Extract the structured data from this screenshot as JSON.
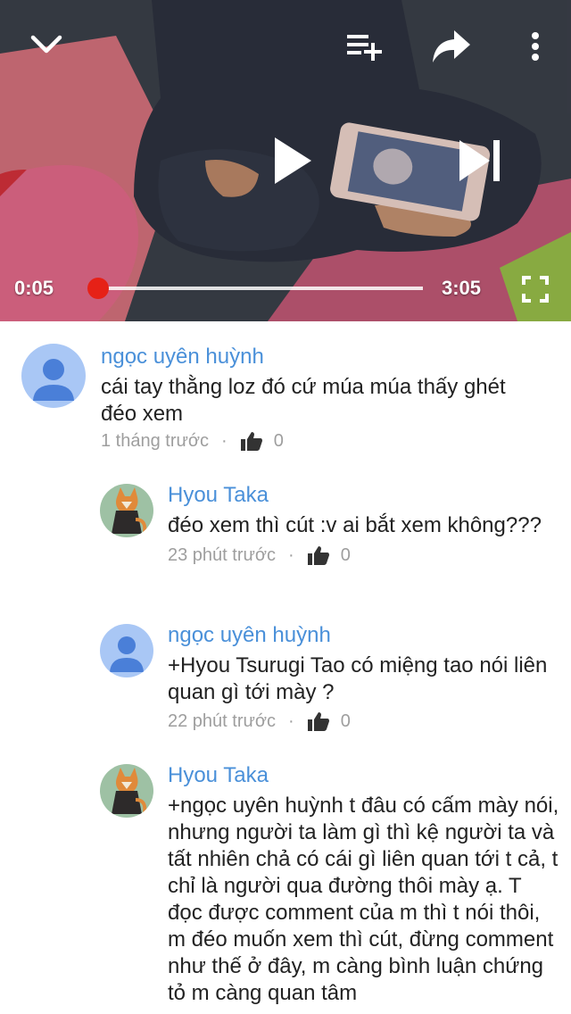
{
  "player": {
    "current_time": "0:05",
    "duration": "3:05",
    "progress": 0.027,
    "icons": {
      "collapse": "chevron-down-icon",
      "add_to_playlist": "playlist-add-icon",
      "share": "share-icon",
      "more": "more-vert-icon",
      "play": "play-icon",
      "next": "skip-next-icon",
      "fullscreen": "fullscreen-icon"
    },
    "accent": "#e62117"
  },
  "comments": [
    {
      "author": "ngọc uyên huỳnh",
      "text": "cái tay thằng loz đó cứ múa múa thấy ghét đéo xem",
      "time": "1 tháng trước",
      "likes": "0",
      "avatar": "default-avatar"
    },
    {
      "author": "Hyou Taka",
      "text": "đéo xem thì cút :v ai bắt xem không???",
      "time": "23 phút trước",
      "likes": "0",
      "avatar": "fox-avatar"
    },
    {
      "author": "ngọc uyên huỳnh",
      "text": "+Hyou Tsurugi Tao có miệng tao nói liên quan gì tới mày ?",
      "time": "22 phút trước",
      "likes": "0",
      "avatar": "default-avatar"
    },
    {
      "author": "Hyou Taka",
      "text": "+ngọc uyên huỳnh t đâu có cấm mày nói, nhưng người ta làm gì thì kệ người ta và tất nhiên chả có cái gì liên quan tới t cả, t chỉ là người qua đường thôi mày ạ. T đọc được comment của m thì t nói thôi, m đéo muốn xem thì cút, đừng comment như thế ở đây, m càng bình luận chứng tỏ m càng quan tâm",
      "time": "",
      "likes": "",
      "avatar": "fox-avatar"
    }
  ],
  "colors": {
    "author": "#4a90d9",
    "text": "#222222",
    "meta": "#9e9e9e"
  }
}
